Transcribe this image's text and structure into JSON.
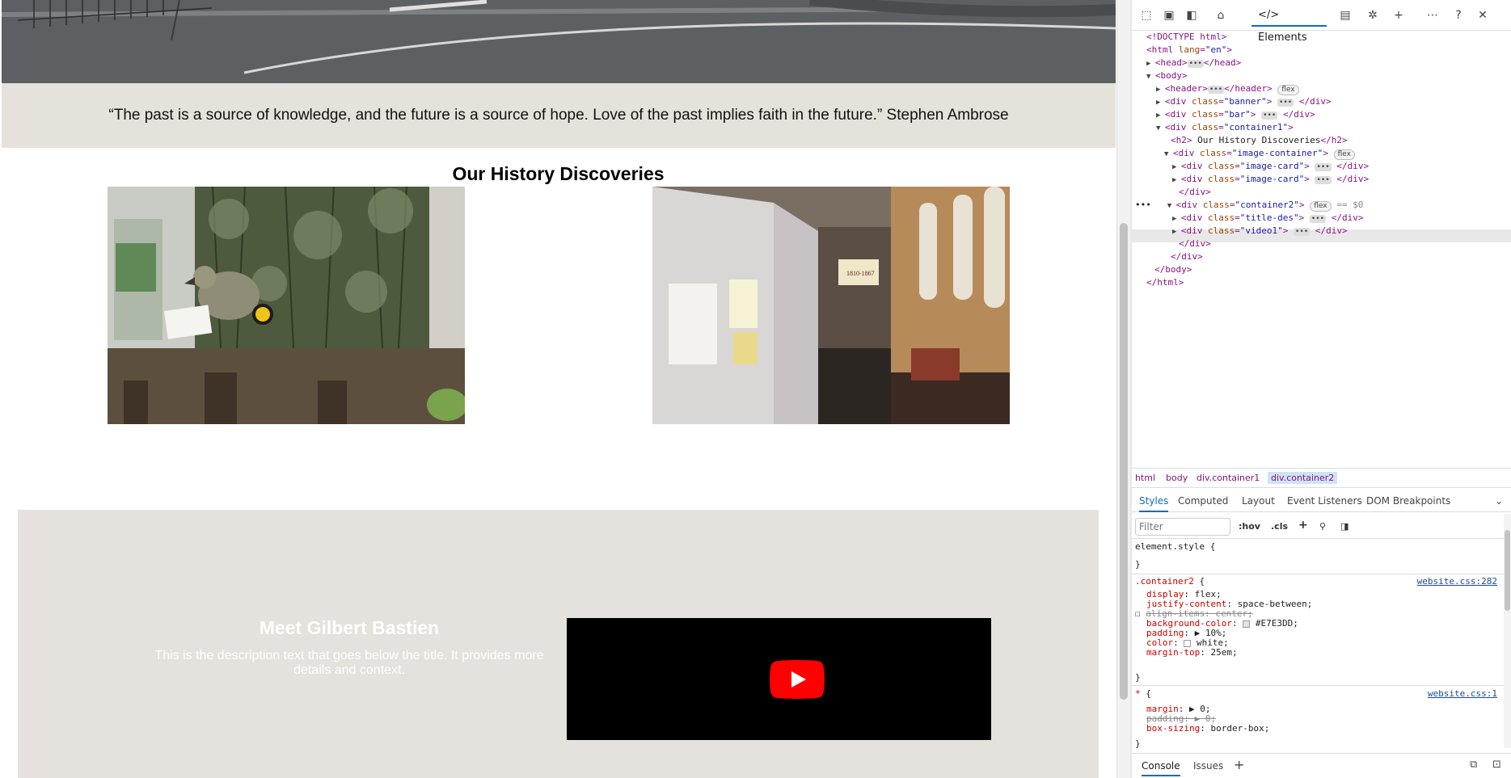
{
  "page": {
    "quote": "“The past is a source of knowledge, and the future is a source of hope. Love of the past implies faith in the future.” Stephen Ambrose",
    "heading": "Our History Discoveries",
    "meet": {
      "title": "Meet Gilbert Bastien",
      "description": "This is the description text that goes below the title. It provides more details and context."
    },
    "colors": {
      "quote_bar": "#e5e2dc",
      "container2_bg": "#E7E3DD",
      "video_bg": "#000000",
      "youtube_red": "#ff0000"
    },
    "exhibit_sign": "1810-1867"
  },
  "devtools": {
    "toolbar": {
      "elements_tab": "Elements",
      "icons": [
        "inspect-icon",
        "device-toggle-icon",
        "dock-sidebar-icon",
        "home-icon",
        "elements-code-icon",
        "console-error-icon",
        "bug-icon",
        "add-tab-icon",
        "more-icon",
        "help-icon",
        "close-icon"
      ]
    },
    "dom": {
      "doctype": "<!DOCTYPE html>",
      "html_open": "<html ",
      "lang_attr": "lang",
      "lang_val": "\"en\"",
      "head": "<head>",
      "head_close": "</head>",
      "body_open": "<body>",
      "header": "<header>",
      "header_close": "</header>",
      "flex": "flex",
      "div": "<div ",
      "class_attr": "class",
      "banner": "\"banner\"",
      "bar": "\"bar\"",
      "container1": "\"container1\"",
      "div_close": "</div>",
      "h2_line_open": "<h2>",
      "h2_text": " Our History Discoveries",
      "h2_close": "</h2>",
      "image_container": "\"image-container\"",
      "image_card": "\"image-card\"",
      "container2": "\"container2\"",
      "eq": "== $0",
      "title_des": "\"title-des\"",
      "video1": "\"video1\"",
      "body_close": "</body>",
      "html_close": "</html>",
      "gt": ">",
      "eqsign": "=",
      "dots_row": "•••",
      "ellipsis": "•••"
    },
    "breadcrumbs": [
      "html",
      "body",
      "div.container1",
      "div.container2"
    ],
    "subtabs": [
      "Styles",
      "Computed",
      "Layout",
      "Event Listeners",
      "DOM Breakpoints"
    ],
    "filter": {
      "placeholder": "Filter",
      "hov": ":hov",
      "cls": ".cls"
    },
    "styles": {
      "element_style": "element.style {",
      "close_brace": "}",
      "rule1_selector": ".container2",
      "open_brace": " {",
      "rule1_source": "website.css:282",
      "rule1_props": [
        {
          "name": "display",
          "value": "flex;",
          "strike": false
        },
        {
          "name": "justify-content",
          "value": "space-between;",
          "strike": false
        },
        {
          "name": "align-items",
          "value": "center;",
          "strike": true
        },
        {
          "name": "background-color",
          "value": "#E7E3DD;",
          "strike": false
        },
        {
          "name": "padding",
          "value": "▶ 10%;",
          "strike": false
        },
        {
          "name": "color",
          "value": "white;",
          "strike": false
        },
        {
          "name": "margin-top",
          "value": "25em;",
          "strike": false
        }
      ],
      "rule2_selector": "*",
      "rule2_source": "website.css:1",
      "rule2_props": [
        {
          "name": "margin",
          "value": "▶ 0;",
          "strike": false
        },
        {
          "name": "padding",
          "value": "▶ 0;",
          "strike": true
        },
        {
          "name": "box-sizing",
          "value": "border-box;",
          "strike": false
        }
      ]
    },
    "drawer": {
      "console": "Console",
      "issues": "Issues"
    }
  }
}
